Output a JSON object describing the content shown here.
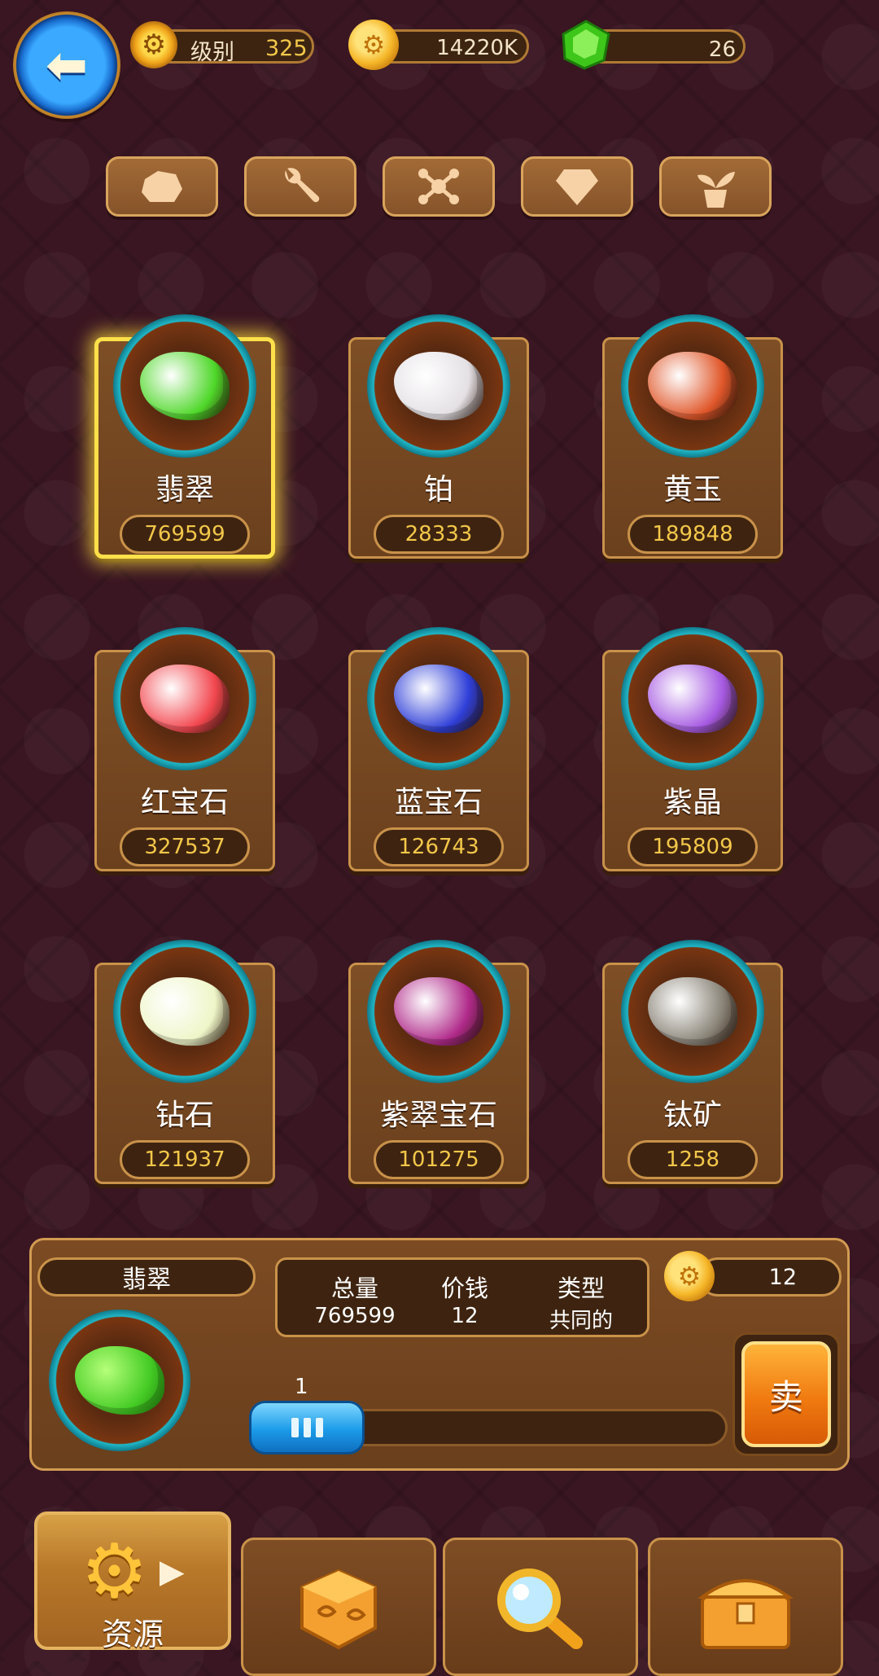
{
  "hud": {
    "level_label": "级别",
    "level_value": "325",
    "coins": "14220K",
    "gems": "26"
  },
  "filters": [
    {
      "icon": "stone-icon"
    },
    {
      "icon": "wrench-icon"
    },
    {
      "icon": "molecule-icon"
    },
    {
      "icon": "diamond-icon"
    },
    {
      "icon": "plant-icon"
    }
  ],
  "items": [
    {
      "name": "翡翠",
      "count": "769599",
      "selected": true,
      "color": "#4fd82a"
    },
    {
      "name": "铂",
      "count": "28333",
      "color": "#e4e0e4"
    },
    {
      "name": "黄玉",
      "count": "189848",
      "color": "#e0572a"
    },
    {
      "name": "红宝石",
      "count": "327537",
      "color": "#f2474f"
    },
    {
      "name": "蓝宝石",
      "count": "126743",
      "color": "#2f3fd8"
    },
    {
      "name": "紫晶",
      "count": "195809",
      "color": "#a65ae2"
    },
    {
      "name": "钻石",
      "count": "121937",
      "color": "#eef6c8"
    },
    {
      "name": "紫翠宝石",
      "count": "101275",
      "color": "#b02a8a"
    },
    {
      "name": "钛矿",
      "count": "1258",
      "color": "#8a8478"
    }
  ],
  "detail": {
    "name": "翡翠",
    "headers": {
      "total": "总量",
      "price": "价钱",
      "type": "类型"
    },
    "values": {
      "total": "769599",
      "price": "12",
      "type": "共同的"
    },
    "sell_price": "12",
    "quantity": "1",
    "sell_label": "卖"
  },
  "nav": [
    {
      "label": "资源",
      "icon": "gear-icon",
      "active": true
    },
    {
      "label": "",
      "icon": "dice-icon"
    },
    {
      "label": "",
      "icon": "magnifier-icon"
    },
    {
      "label": "",
      "icon": "chest-icon"
    }
  ]
}
